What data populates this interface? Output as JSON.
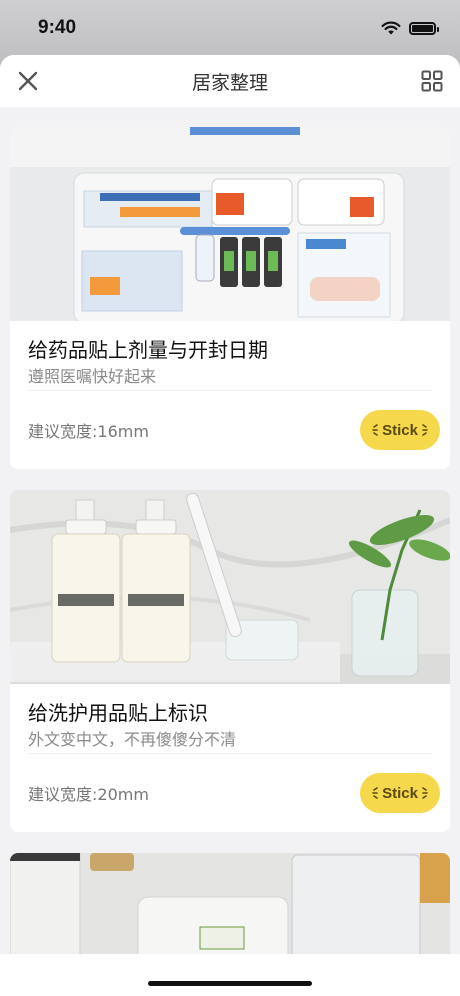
{
  "status": {
    "time": "9:40"
  },
  "nav": {
    "title": "居家整理",
    "close_icon": "close-icon",
    "grid_icon": "grid-icon"
  },
  "cards": [
    {
      "title": "给药品贴上剂量与开封日期",
      "subtitle": "遵照医嘱快好起来",
      "width_label": "建议宽度:16mm",
      "button_label": "Stick",
      "image": "medicine-box-photo"
    },
    {
      "title": "给洗护用品贴上标识",
      "subtitle": "外文变中文，不再傻傻分不清",
      "width_label": "建议宽度:20mm",
      "button_label": "Stick",
      "image": "toiletries-photo"
    }
  ],
  "partial_card": {
    "image": "kitchen-containers-photo"
  },
  "colors": {
    "accent": "#f5d84b",
    "background": "#f2f2f4"
  }
}
